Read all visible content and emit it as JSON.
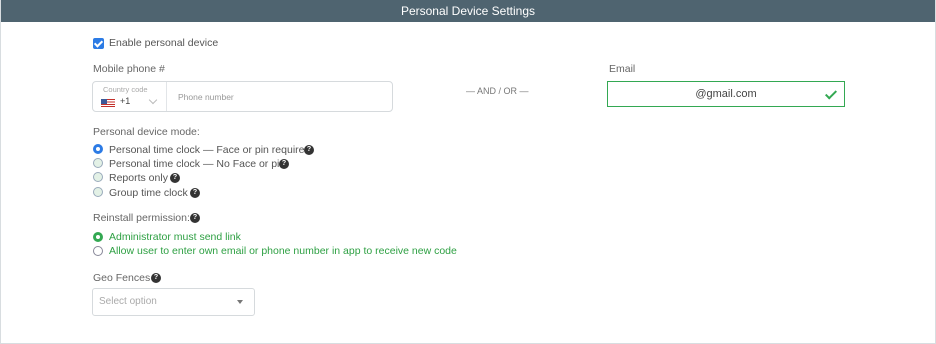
{
  "header": {
    "title": "Personal Device Settings"
  },
  "enable": {
    "label": "Enable personal device",
    "checked": true
  },
  "phone": {
    "section_label": "Mobile phone #",
    "country_code_label": "Country code",
    "country_code_value": "+1",
    "country_flag": "us-flag-icon",
    "placeholder": "Phone number"
  },
  "separator": "— AND / OR —",
  "email": {
    "section_label": "Email",
    "value": "@gmail.com",
    "valid": true,
    "accent": "#33a852"
  },
  "device_mode": {
    "section_label": "Personal device mode:",
    "options": [
      {
        "label": "Personal time clock — Face or pin required",
        "selected": true
      },
      {
        "label": "Personal time clock — No Face or pin",
        "selected": false
      },
      {
        "label": "Reports only",
        "selected": false
      },
      {
        "label": "Group time clock",
        "selected": false
      }
    ]
  },
  "reinstall": {
    "section_label": "Reinstall permission:",
    "options": [
      {
        "label": "Administrator must send link",
        "selected": true
      },
      {
        "label": "Allow user to enter own email or phone number in app to receive new code",
        "selected": false
      }
    ]
  },
  "geo": {
    "section_label": "Geo Fences",
    "placeholder": "Select option"
  },
  "help_glyph": "?",
  "colors": {
    "header_bg": "#4f6470",
    "accent_blue": "#2c7be5",
    "accent_green": "#33a852"
  }
}
